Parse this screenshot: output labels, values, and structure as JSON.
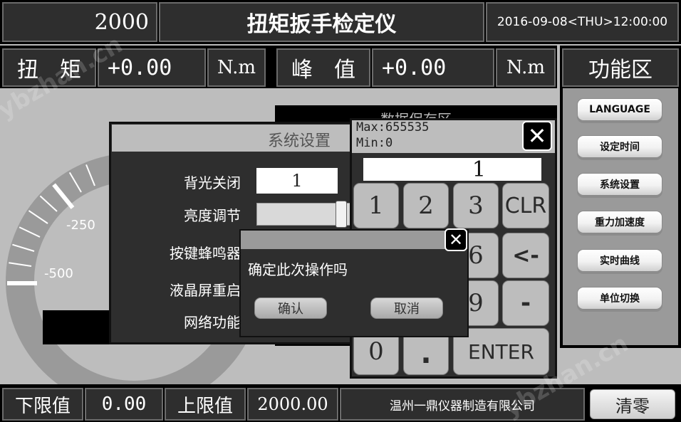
{
  "header": {
    "max_value": "2000",
    "title": "扭矩扳手检定仪",
    "datetime": "2016-09-08<THU>12:00:00"
  },
  "readouts": {
    "torque_label": "扭　矩",
    "torque_value": "+0.00",
    "torque_unit": "N.m",
    "peak_label": "峰　值",
    "peak_value": "+0.00",
    "peak_unit": "N.m"
  },
  "function_panel": {
    "title": "功能区",
    "buttons": [
      "LANGUAGE",
      "设定时间",
      "系统设置",
      "重力加速度",
      "实时曲线",
      "单位切换"
    ]
  },
  "dial": {
    "labels": [
      "-250",
      "-500"
    ]
  },
  "data_save_panel": {
    "title": "数据保存区"
  },
  "system_settings": {
    "title": "系统设置",
    "rows": [
      {
        "label": "背光关闭",
        "value": "1"
      },
      {
        "label": "亮度调节"
      },
      {
        "label": "按键蜂鸣器"
      },
      {
        "label": "液晶屏重启"
      },
      {
        "label": "网络功能"
      }
    ]
  },
  "keypad": {
    "max_text": "Max:655535",
    "min_text": "Min:0",
    "entry_value": "1",
    "keys": [
      "1",
      "2",
      "3",
      "CLR",
      "6",
      "<-",
      "9",
      "-",
      "0",
      ".",
      "ENTER"
    ]
  },
  "confirm_dialog": {
    "message": "确定此次操作吗",
    "ok_label": "确认",
    "cancel_label": "取消"
  },
  "footer": {
    "lower_label": "下限值",
    "lower_value": "0.00",
    "upper_label": "上限值",
    "upper_value": "2000.00",
    "company": "温州一鼎仪器制造有限公司",
    "clear_label": "清零"
  },
  "watermark": "ybzhan.cn"
}
